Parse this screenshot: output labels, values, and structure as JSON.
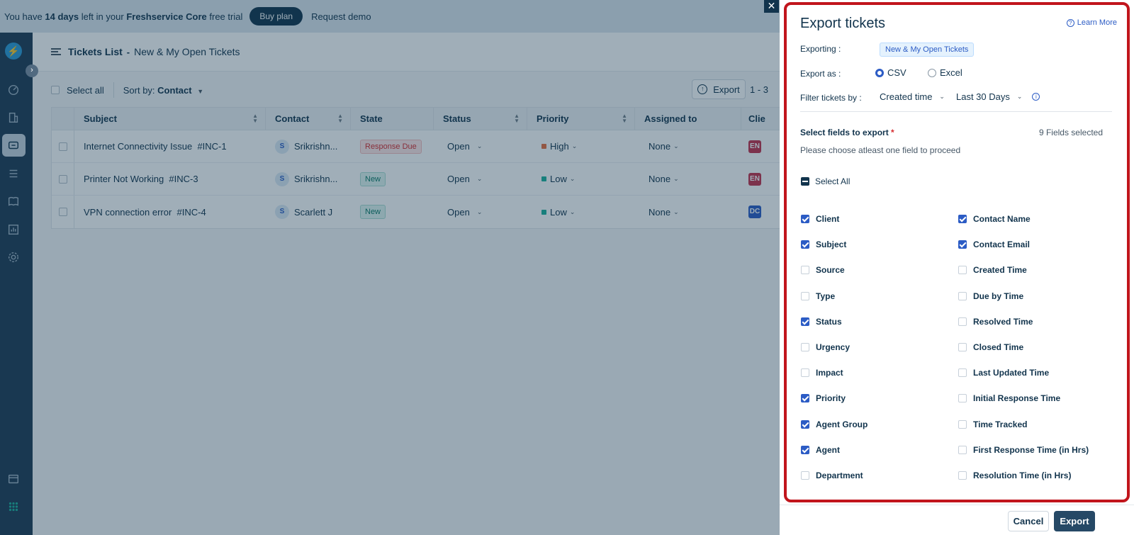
{
  "banner": {
    "prefix": "You have",
    "days": "14 days",
    "middle": "left in your",
    "product": "Freshservice Core",
    "suffix": "free trial",
    "buy_label": "Buy plan",
    "demo_label": "Request demo"
  },
  "header": {
    "title": "Tickets List",
    "separator": "-",
    "view": "New & My Open Tickets"
  },
  "toolbar": {
    "select_all": "Select all",
    "sort_prefix": "Sort by:",
    "sort_value": "Contact",
    "export_label": "Export",
    "pager": "1 - 3"
  },
  "table": {
    "columns": [
      "Subject",
      "Contact",
      "State",
      "Status",
      "Priority",
      "Assigned to",
      "Clie"
    ],
    "rows": [
      {
        "subject": "Internet Connectivity Issue",
        "id": "#INC-1",
        "avatar": "S",
        "contact": "Srikrishn...",
        "state": "Response Due",
        "status": "Open",
        "priority": "High",
        "assigned": "None",
        "client": "EN"
      },
      {
        "subject": "Printer Not Working",
        "id": "#INC-3",
        "avatar": "S",
        "contact": "Srikrishn...",
        "state": "New",
        "status": "Open",
        "priority": "Low",
        "assigned": "None",
        "client": "EN"
      },
      {
        "subject": "VPN connection error",
        "id": "#INC-4",
        "avatar": "S",
        "contact": "Scarlett J",
        "state": "New",
        "status": "Open",
        "priority": "Low",
        "assigned": "None",
        "client": "DC"
      }
    ]
  },
  "panel": {
    "title": "Export tickets",
    "learn_more": "Learn More",
    "exporting_label": "Exporting :",
    "exporting_value": "New & My Open Tickets",
    "export_as_label": "Export as :",
    "format_csv": "CSV",
    "format_excel": "Excel",
    "selected_format": "CSV",
    "filter_label": "Filter tickets by :",
    "filter_field": "Created time",
    "filter_range": "Last 30 Days",
    "fields_title": "Select fields to export",
    "required_mark": "*",
    "fields_count": "9 Fields selected",
    "fields_help": "Please choose atleast one field to proceed",
    "select_all": "Select All",
    "fields_left": [
      {
        "label": "Client",
        "checked": true
      },
      {
        "label": "Subject",
        "checked": true
      },
      {
        "label": "Source",
        "checked": false
      },
      {
        "label": "Type",
        "checked": false
      },
      {
        "label": "Status",
        "checked": true
      },
      {
        "label": "Urgency",
        "checked": false
      },
      {
        "label": "Impact",
        "checked": false
      },
      {
        "label": "Priority",
        "checked": true
      },
      {
        "label": "Agent Group",
        "checked": true
      },
      {
        "label": "Agent",
        "checked": true
      },
      {
        "label": "Department",
        "checked": false
      }
    ],
    "fields_right": [
      {
        "label": "Contact Name",
        "checked": true
      },
      {
        "label": "Contact Email",
        "checked": true
      },
      {
        "label": "Created Time",
        "checked": false
      },
      {
        "label": "Due by Time",
        "checked": false
      },
      {
        "label": "Resolved Time",
        "checked": false
      },
      {
        "label": "Closed Time",
        "checked": false
      },
      {
        "label": "Last Updated Time",
        "checked": false
      },
      {
        "label": "Initial Response Time",
        "checked": false
      },
      {
        "label": "Time Tracked",
        "checked": false
      },
      {
        "label": "First Response Time (in Hrs)",
        "checked": false
      },
      {
        "label": "Resolution Time (in Hrs)",
        "checked": false
      }
    ],
    "cancel_label": "Cancel",
    "export_label": "Export"
  },
  "colors": {
    "priority_high": "#e86f3f",
    "priority_low": "#1db19c",
    "client_en": "#c4314b",
    "client_dc": "#2c5cc5",
    "panel_highlight": "#c1151c"
  }
}
